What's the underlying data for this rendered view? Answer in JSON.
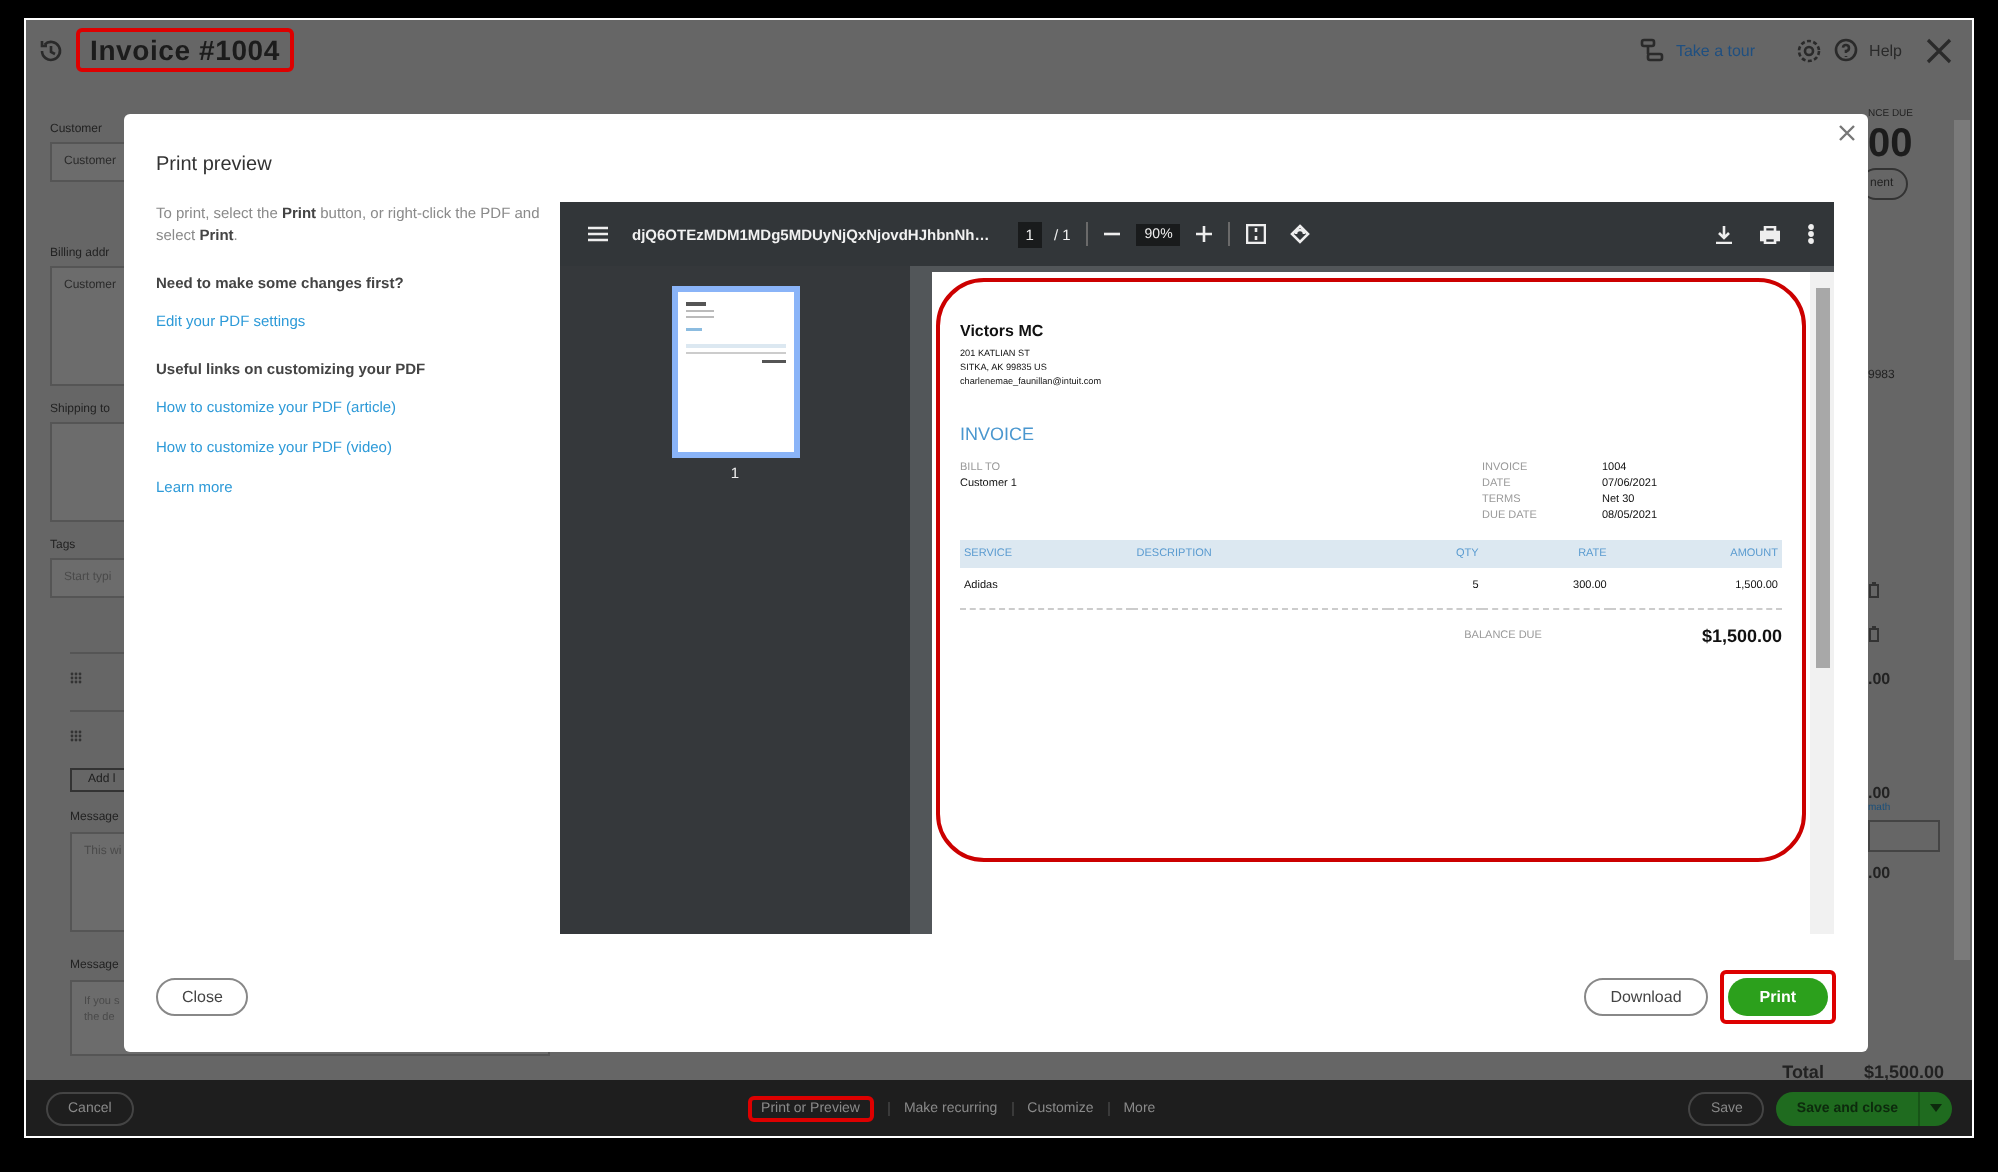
{
  "app": {
    "title": "Invoice #1004",
    "title_highlighted": true,
    "tour": "Take a tour",
    "help": "Help"
  },
  "form": {
    "customer_label": "Customer",
    "customer_value": "Customer",
    "billing_label": "Billing addr",
    "billing_value": "Customer",
    "shipping_label": "Shipping to",
    "tags_label": "Tags",
    "tags_placeholder": "Start typi",
    "add_button": "Add l",
    "message_label": "Message",
    "message_placeholder": "This wi",
    "statement_label": "Message",
    "statement_placeholder": "If you s the de"
  },
  "summary": {
    "balance_label": "NCE DUE",
    "balance_value": "00",
    "payment_button": "nent",
    "zip": "9983",
    "amounts": [
      ".00",
      ".00"
    ],
    "link": "math",
    "subtotal": ".00",
    "total_label": "Total",
    "total_value": "$1,500.00"
  },
  "modal": {
    "title": "Print preview",
    "instructions": "To print, select the **Print** button, or right-click the PDF and select **Print**.",
    "sections": [
      {
        "kind": "heading",
        "text": "Need to make some changes first?"
      },
      {
        "kind": "link",
        "text": "Edit your PDF settings"
      },
      {
        "kind": "heading",
        "text": "Useful links on customizing your PDF"
      },
      {
        "kind": "link",
        "text": "How to customize your PDF (article)"
      },
      {
        "kind": "link",
        "text": "How to customize your PDF (video)"
      },
      {
        "kind": "link",
        "text": "Learn more"
      }
    ],
    "viewer": {
      "filename": "djQ6OTEzMDM1MDg5MDUyNjQxNjovdHJhbnNh…",
      "page": "1",
      "page_count": "/ 1",
      "zoom": "90%",
      "thumbnail_label": "1",
      "thumbnail_selected": true
    },
    "document": {
      "highlighted": true,
      "company": "Victors MC",
      "address": [
        "201 KATLIAN ST",
        "SITKA, AK  99835 US",
        "charlenemae_faunillan@intuit.com"
      ],
      "heading": "INVOICE",
      "bill_to_label": "BILL TO",
      "bill_to": "Customer 1",
      "meta": [
        {
          "label": "INVOICE",
          "value": "1004"
        },
        {
          "label": "DATE",
          "value": "07/06/2021"
        },
        {
          "label": "TERMS",
          "value": "Net 30"
        },
        {
          "label": "DUE DATE",
          "value": "08/05/2021"
        }
      ],
      "columns": [
        "SERVICE",
        "DESCRIPTION",
        "QTY",
        "RATE",
        "AMOUNT"
      ],
      "rows": [
        {
          "service": "Adidas",
          "qty": "5",
          "rate": "300.00",
          "amount": "1,500.00"
        }
      ],
      "balance_label": "BALANCE DUE",
      "balance": "$1,500.00"
    },
    "close": "Close",
    "download": "Download",
    "print": "Print",
    "print_highlighted": true
  },
  "footer": {
    "cancel": "Cancel",
    "actions": [
      {
        "label": "Print or Preview",
        "highlighted": true
      },
      {
        "label": "Make recurring",
        "highlighted": false
      },
      {
        "label": "Customize",
        "highlighted": false
      },
      {
        "label": "More",
        "highlighted": false
      }
    ],
    "save": "Save",
    "save_close": "Save and close"
  }
}
